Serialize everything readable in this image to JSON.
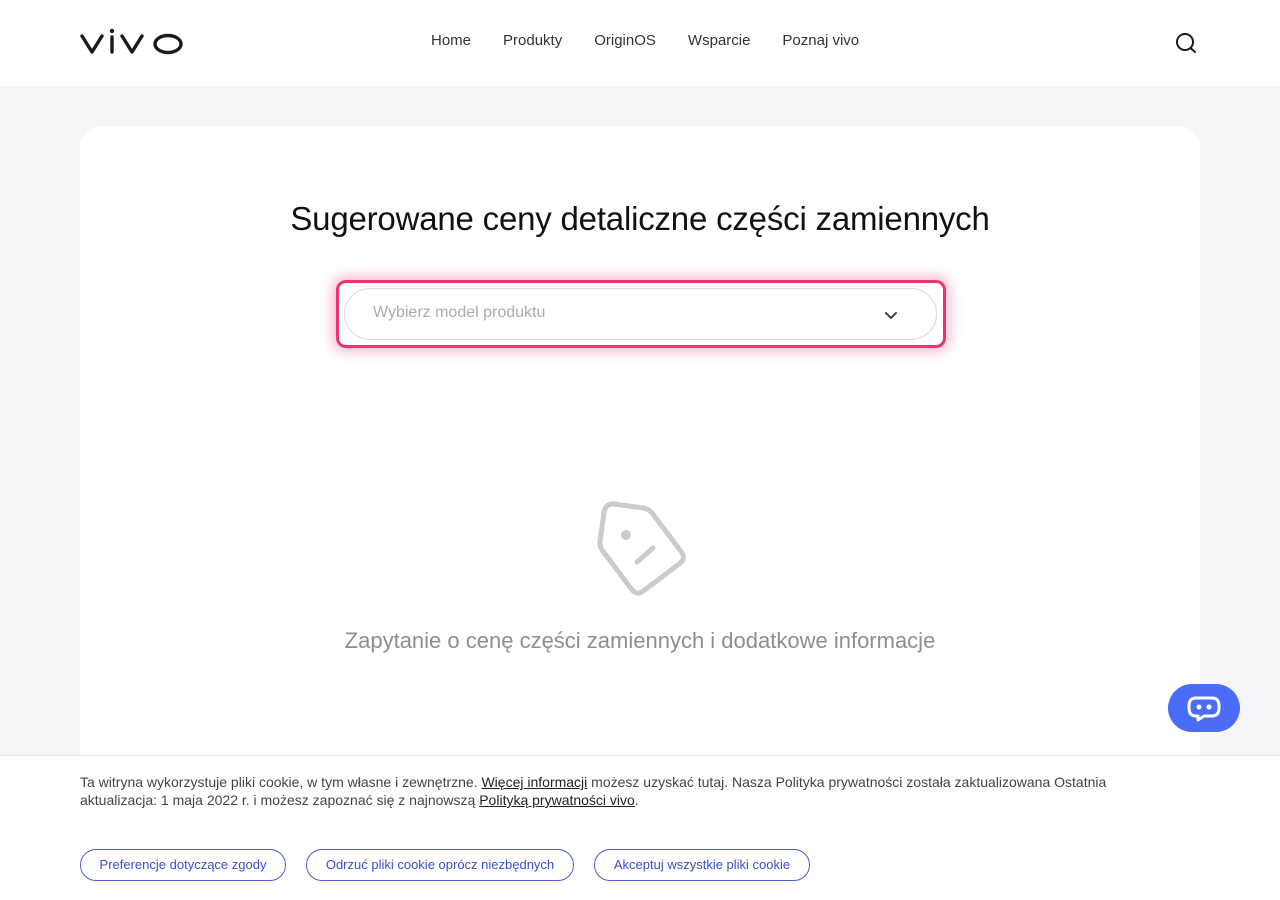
{
  "header": {
    "logo_text": "vivo",
    "nav": [
      "Home",
      "Produkty",
      "OriginOS",
      "Wsparcie",
      "Poznaj vivo"
    ],
    "search_icon": "search-icon"
  },
  "main": {
    "title": "Sugerowane ceny detaliczne części zamiennych",
    "select_placeholder": "Wybierz model produktu",
    "empty_text": "Zapytanie o cenę części zamiennych i dodatkowe informacje",
    "empty_icon": "tag-sad-face-icon"
  },
  "chat": {
    "icon": "chatbot-icon",
    "color": "#4a6cf7"
  },
  "cookie": {
    "text_part1": "Ta witryna wykorzystuje pliki cookie, w tym własne i zewnętrzne. ",
    "link1": "Więcej informacji",
    "text_part2": " możesz uzyskać tutaj. Nasza Polityka prywatności została zaktualizowana Ostatnia aktualizacja: 1 maja 2022 r. i możesz zapoznać się z najnowszą ",
    "link2": "Polityką prywatności vivo",
    "text_part3": ".",
    "buttons": [
      "Preferencje dotyczące zgody",
      "Odrzuć pliki cookie oprócz niezbędnych",
      "Akceptuj wszystkie pliki cookie"
    ]
  },
  "colors": {
    "accent": "#4a6cf7",
    "highlight": "#e8356d",
    "cookie_button": "#3a4fc9"
  }
}
